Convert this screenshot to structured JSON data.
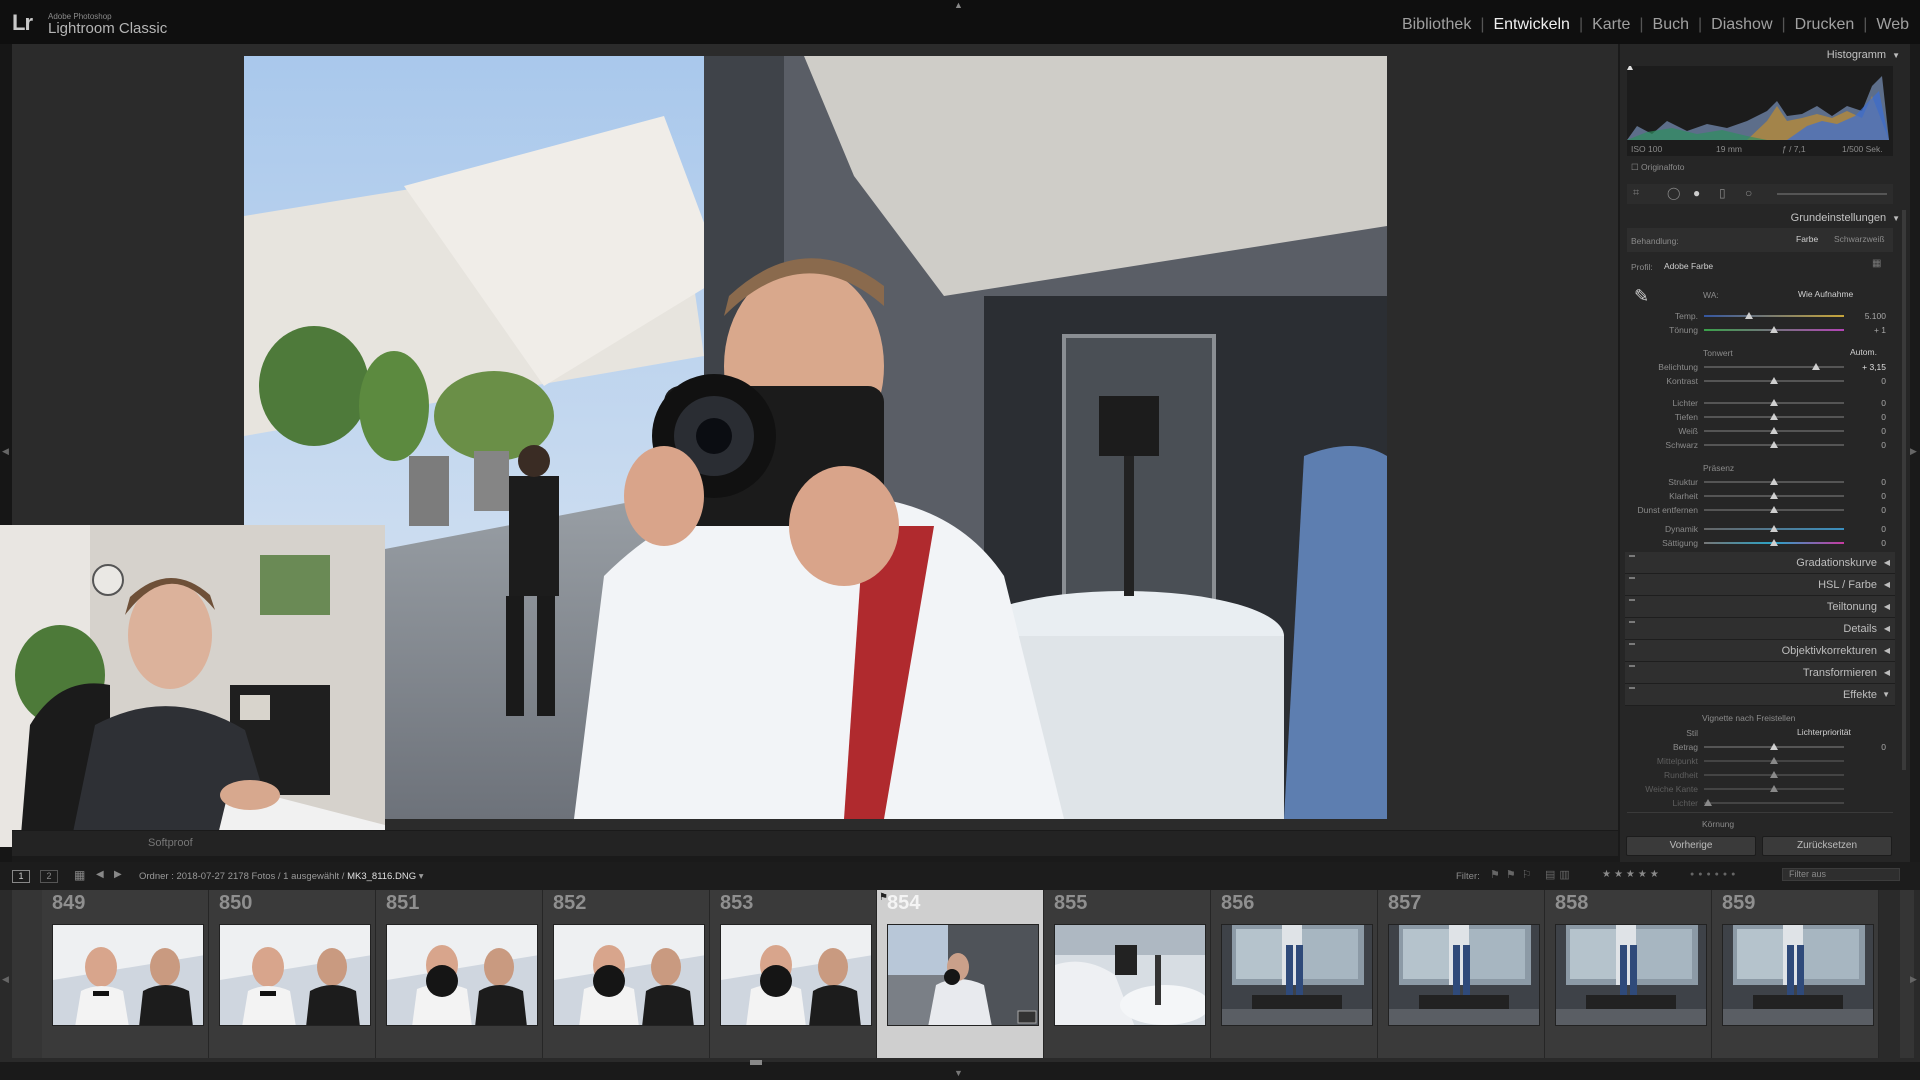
{
  "app": {
    "logo": "Lr",
    "subtitle": "Adobe Photoshop",
    "title": "Lightroom Classic"
  },
  "modules": [
    {
      "label": "Bibliothek",
      "active": false
    },
    {
      "label": "Entwickeln",
      "active": true
    },
    {
      "label": "Karte",
      "active": false
    },
    {
      "label": "Buch",
      "active": false
    },
    {
      "label": "Diashow",
      "active": false
    },
    {
      "label": "Drucken",
      "active": false
    },
    {
      "label": "Web",
      "active": false
    }
  ],
  "toolbar": {
    "softproof": "Softproof"
  },
  "histogram": {
    "title": "Histogramm",
    "iso": "ISO 100",
    "focal": "19 mm",
    "aperture": "ƒ / 7,1",
    "shutter": "1/500 Sek.",
    "original_photo": "Originalfoto"
  },
  "basic": {
    "title": "Grundeinstellungen",
    "treatment_label": "Behandlung:",
    "treatment_color": "Farbe",
    "treatment_bw": "Schwarzweiß",
    "profile_label": "Profil:",
    "profile_value": "Adobe Farbe",
    "wb_label": "WA:",
    "wb_value": "Wie Aufnahme",
    "temp_label": "Temp.",
    "temp_value": "5.100",
    "tint_label": "Tönung",
    "tint_value": "+ 1",
    "tone_label": "Tonwert",
    "auto_label": "Autom.",
    "exposure_label": "Belichtung",
    "exposure_value": "+ 3,15",
    "contrast_label": "Kontrast",
    "contrast_value": "0",
    "highlights_label": "Lichter",
    "highlights_value": "0",
    "shadows_label": "Tiefen",
    "shadows_value": "0",
    "whites_label": "Weiß",
    "whites_value": "0",
    "blacks_label": "Schwarz",
    "blacks_value": "0",
    "presence_label": "Präsenz",
    "texture_label": "Struktur",
    "texture_value": "0",
    "clarity_label": "Klarheit",
    "clarity_value": "0",
    "dehaze_label": "Dunst entfernen",
    "dehaze_value": "0",
    "vibrance_label": "Dynamik",
    "vibrance_value": "0",
    "saturation_label": "Sättigung",
    "saturation_value": "0"
  },
  "sections": {
    "tone_curve": "Gradationskurve",
    "hsl": "HSL / Farbe",
    "split_toning": "Teiltonung",
    "details": "Details",
    "lens": "Objektivkorrekturen",
    "transform": "Transformieren",
    "effects": "Effekte"
  },
  "effects": {
    "vignette_title": "Vignette nach Freistellen",
    "style_label": "Stil",
    "style_value": "Lichterpriorität",
    "amount_label": "Betrag",
    "amount_value": "0",
    "midpoint_label": "Mittelpunkt",
    "roundness_label": "Rundheit",
    "feather_label": "Weiche Kante",
    "highlights_label": "Lichter",
    "grain_label": "Körnung"
  },
  "buttons": {
    "previous": "Vorherige",
    "reset": "Zurücksetzen"
  },
  "filmstrip_bar": {
    "page1": "1",
    "page2": "2",
    "path_prefix": "Ordner : 2018-07-27",
    "count": "2178 Fotos / 1 ausgewählt /",
    "filename": "MK3_8116.DNG",
    "filter_label": "Filter:",
    "filter_value": "Filter aus"
  },
  "filmstrip": [
    {
      "num": "849",
      "selected": false,
      "kind": "group"
    },
    {
      "num": "850",
      "selected": false,
      "kind": "group"
    },
    {
      "num": "851",
      "selected": false,
      "kind": "camera"
    },
    {
      "num": "852",
      "selected": false,
      "kind": "camera"
    },
    {
      "num": "853",
      "selected": false,
      "kind": "camera"
    },
    {
      "num": "854",
      "selected": true,
      "kind": "current"
    },
    {
      "num": "855",
      "selected": false,
      "kind": "gimbal"
    },
    {
      "num": "856",
      "selected": false,
      "kind": "legs"
    },
    {
      "num": "857",
      "selected": false,
      "kind": "legs"
    },
    {
      "num": "858",
      "selected": false,
      "kind": "legs"
    },
    {
      "num": "859",
      "selected": false,
      "kind": "legs"
    }
  ]
}
